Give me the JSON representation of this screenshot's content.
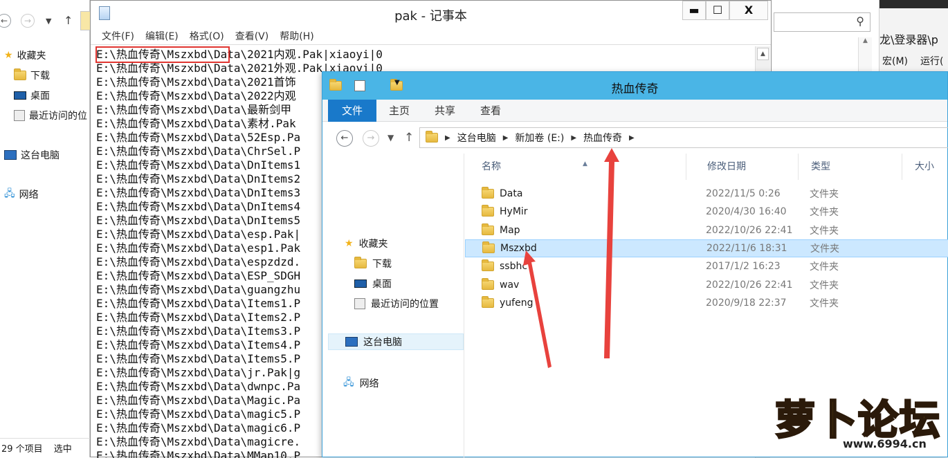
{
  "bg_explorer": {
    "tree": [
      "收藏夹",
      "下载",
      "桌面",
      "最近访问的位",
      "这台电脑",
      "网络"
    ],
    "status_count": "29 个项目",
    "status_selected": "选中"
  },
  "bg_right": {
    "path_fragment": "龙\\登录器\\p",
    "menu": [
      "宏(M)",
      "运行("
    ]
  },
  "notepad": {
    "title": "pak - 记事本",
    "menus": [
      "文件(F)",
      "编辑(E)",
      "格式(O)",
      "查看(V)",
      "帮助(H)"
    ],
    "window_buttons": {
      "minimize": "▬",
      "maximize": "☐",
      "close": "X"
    },
    "lines": [
      "E:\\热血传奇\\Mszxbd\\Data\\2021内观.Pak|xiaoyi|0",
      "E:\\热血传奇\\Mszxbd\\Data\\2021外观.Pak|xiaoyi|0",
      "E:\\热血传奇\\Mszxbd\\Data\\2021首饰",
      "E:\\热血传奇\\Mszxbd\\Data\\2022内观",
      "E:\\热血传奇\\Mszxbd\\Data\\最新剑甲",
      "E:\\热血传奇\\Mszxbd\\Data\\素材.Pak",
      "E:\\热血传奇\\Mszxbd\\Data\\52Esp.Pa",
      "E:\\热血传奇\\Mszxbd\\Data\\ChrSel.P",
      "E:\\热血传奇\\Mszxbd\\Data\\DnItems1",
      "E:\\热血传奇\\Mszxbd\\Data\\DnItems2",
      "E:\\热血传奇\\Mszxbd\\Data\\DnItems3",
      "E:\\热血传奇\\Mszxbd\\Data\\DnItems4",
      "E:\\热血传奇\\Mszxbd\\Data\\DnItems5",
      "E:\\热血传奇\\Mszxbd\\Data\\esp.Pak|",
      "E:\\热血传奇\\Mszxbd\\Data\\esp1.Pak",
      "E:\\热血传奇\\Mszxbd\\Data\\espzdzd.",
      "E:\\热血传奇\\Mszxbd\\Data\\ESP_SDGH",
      "E:\\热血传奇\\Mszxbd\\Data\\guangzhu",
      "E:\\热血传奇\\Mszxbd\\Data\\Items1.P",
      "E:\\热血传奇\\Mszxbd\\Data\\Items2.P",
      "E:\\热血传奇\\Mszxbd\\Data\\Items3.P",
      "E:\\热血传奇\\Mszxbd\\Data\\Items4.P",
      "E:\\热血传奇\\Mszxbd\\Data\\Items5.P",
      "E:\\热血传奇\\Mszxbd\\Data\\jr.Pak|g",
      "E:\\热血传奇\\Mszxbd\\Data\\dwnpc.Pa",
      "E:\\热血传奇\\Mszxbd\\Data\\Magic.Pa",
      "E:\\热血传奇\\Mszxbd\\Data\\magic5.P",
      "E:\\热血传奇\\Mszxbd\\Data\\magic6.P",
      "E:\\热血传奇\\Mszxbd\\Data\\magicre.",
      "E:\\热血传奇\\Mszxbd\\Data\\MMap10.P"
    ]
  },
  "explorer": {
    "title": "热血传奇",
    "ribbon_tabs": [
      "文件",
      "主页",
      "共享",
      "查看"
    ],
    "breadcrumb": [
      "这台电脑",
      "新加卷 (E:)",
      "热血传奇"
    ],
    "nav": {
      "favorites": "收藏夹",
      "downloads": "下载",
      "desktop": "桌面",
      "recent": "最近访问的位置",
      "this_pc": "这台电脑",
      "network": "网络"
    },
    "columns": [
      "名称",
      "修改日期",
      "类型",
      "大小"
    ],
    "files": [
      {
        "name": "Data",
        "date": "2022/11/5 0:26",
        "type": "文件夹"
      },
      {
        "name": "HyMir",
        "date": "2020/4/30 16:40",
        "type": "文件夹"
      },
      {
        "name": "Map",
        "date": "2022/10/26 22:41",
        "type": "文件夹"
      },
      {
        "name": "Mszxbd",
        "date": "2022/11/6 18:31",
        "type": "文件夹"
      },
      {
        "name": "ssbhc",
        "date": "2017/1/2 16:23",
        "type": "文件夹"
      },
      {
        "name": "wav",
        "date": "2022/10/26 22:41",
        "type": "文件夹"
      },
      {
        "name": "yufeng",
        "date": "2020/9/18 22:37",
        "type": "文件夹"
      }
    ]
  },
  "watermark": {
    "logo_text": "萝卜论坛",
    "url": "www.6994.cn"
  },
  "colors": {
    "accent_blue": "#1979ca",
    "titlebar_blue": "#4ab5e6",
    "annotation_red": "#e0342f",
    "selection": "#cce8ff"
  }
}
